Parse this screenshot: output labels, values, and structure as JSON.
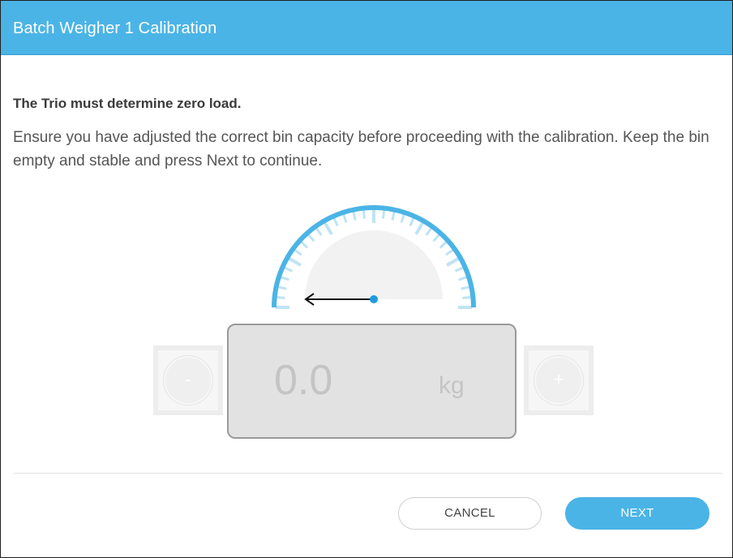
{
  "dialog": {
    "title": "Batch Weigher 1 Calibration",
    "heading": "The Trio must determine zero load.",
    "description": "Ensure you have adjusted the correct bin capacity before proceeding with the calibration. Keep the bin empty and stable and press Next to continue."
  },
  "scale": {
    "value": "0.0",
    "unit": "kg",
    "decrease_label": "-",
    "increase_label": "+"
  },
  "buttons": {
    "cancel": "CANCEL",
    "next": "NEXT"
  },
  "colors": {
    "accent": "#4bb4e6",
    "tick_light": "#bfe3f5"
  },
  "icons": {
    "gauge": "gauge-dial-icon",
    "needle": "arrow-left-icon"
  }
}
